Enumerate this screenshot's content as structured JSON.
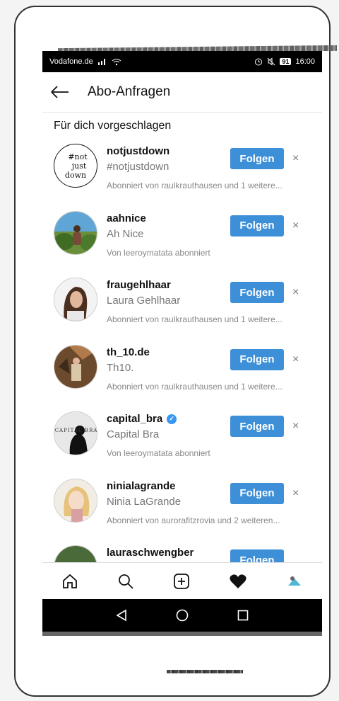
{
  "status": {
    "carrier": "Vodafone.de",
    "battery": "91",
    "time": "16:00"
  },
  "header": {
    "title": "Abo-Anfragen"
  },
  "section": {
    "title": "Für dich vorgeschlagen"
  },
  "follow_label": "Folgen",
  "dismiss_label": "×",
  "suggestions": [
    {
      "username": "notjustdown",
      "fullname": "#notjustdown",
      "meta": "Abonniert von raulkrauthausen und 1 weitere...",
      "avatar_text": [
        "#not",
        "just",
        "down"
      ]
    },
    {
      "username": "aahnice",
      "fullname": "Ah Nice",
      "meta": "Von leeroymatata abonniert"
    },
    {
      "username": "fraugehlhaar",
      "fullname": "Laura Gehlhaar",
      "meta": "Abonniert von raulkrauthausen und 1 weitere..."
    },
    {
      "username": "th_10.de",
      "fullname": "Th10.",
      "meta": "Abonniert von raulkrauthausen und 1 weitere..."
    },
    {
      "username": "capital_bra",
      "fullname": "Capital Bra",
      "meta": "Von leeroymatata abonniert",
      "verified": true,
      "avatar_text": "CAPITAL BRA"
    },
    {
      "username": "ninialagrande",
      "fullname": "Ninia LaGrande",
      "meta": "Abonniert von aurorafitzrovia und 2 weiteren..."
    },
    {
      "username": "lauraschwengber"
    }
  ],
  "tabs": [
    "home-icon",
    "search-icon",
    "add-post-icon",
    "activity-heart-icon",
    "profile-avatar-icon"
  ],
  "colors": {
    "follow": "#3d8fd8",
    "verified": "#3897f0"
  }
}
